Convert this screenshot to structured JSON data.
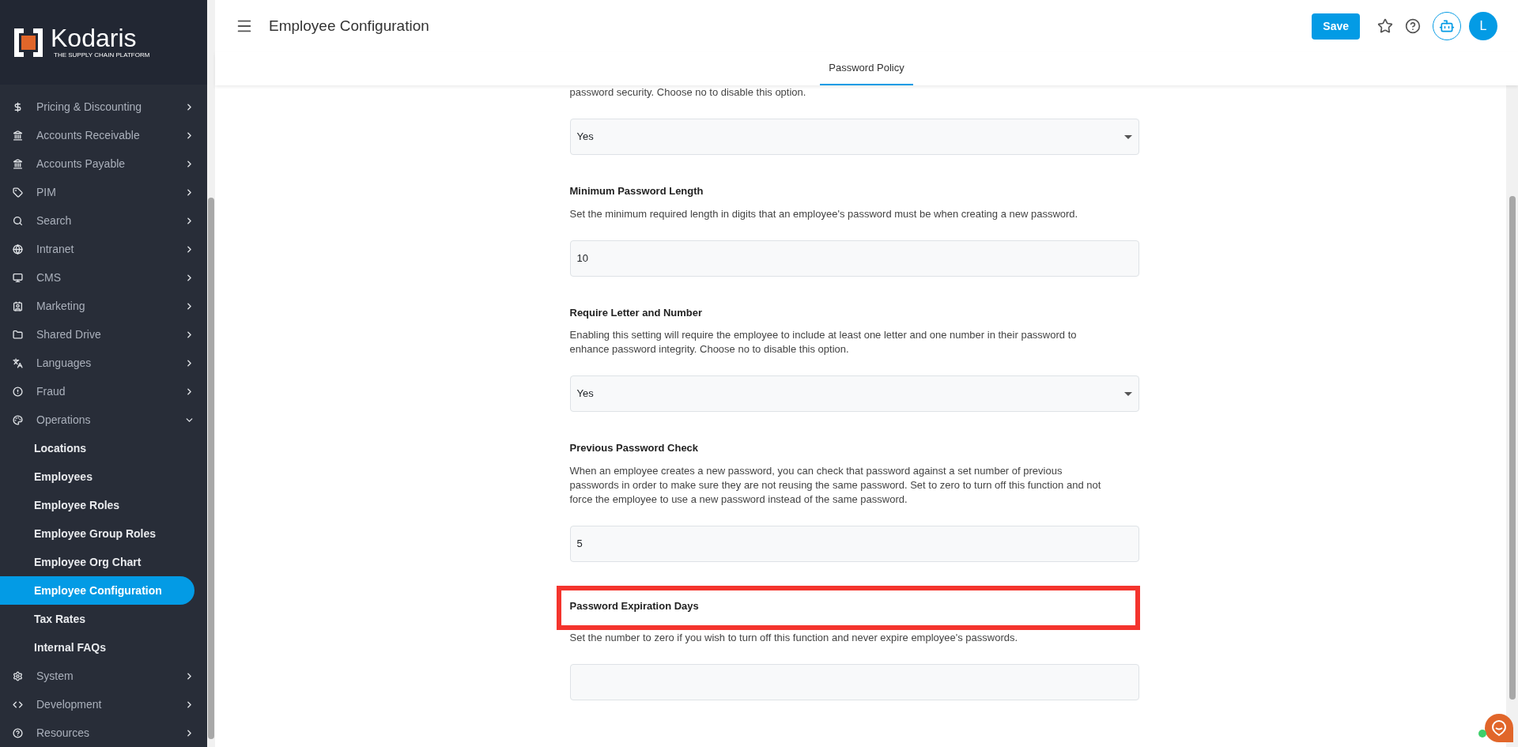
{
  "sidebar": {
    "logo": {
      "name": "Kodaris",
      "tagline": "THE SUPPLY CHAIN PLATFORM"
    },
    "items": [
      {
        "label": "Pricing & Discounting",
        "expanded": false
      },
      {
        "label": "Accounts Receivable",
        "expanded": false
      },
      {
        "label": "Accounts Payable",
        "expanded": false
      },
      {
        "label": "PIM",
        "expanded": false
      },
      {
        "label": "Search",
        "expanded": false
      },
      {
        "label": "Intranet",
        "expanded": false
      },
      {
        "label": "CMS",
        "expanded": false
      },
      {
        "label": "Marketing",
        "expanded": false
      },
      {
        "label": "Shared Drive",
        "expanded": false
      },
      {
        "label": "Languages",
        "expanded": false
      },
      {
        "label": "Fraud",
        "expanded": false
      },
      {
        "label": "Operations",
        "expanded": true,
        "children": [
          {
            "label": "Locations",
            "selected": false
          },
          {
            "label": "Employees",
            "selected": false
          },
          {
            "label": "Employee Roles",
            "selected": false
          },
          {
            "label": "Employee Group Roles",
            "selected": false
          },
          {
            "label": "Employee Org Chart",
            "selected": false
          },
          {
            "label": "Employee Configuration",
            "selected": true
          },
          {
            "label": "Tax Rates",
            "selected": false
          },
          {
            "label": "Internal FAQs",
            "selected": false
          }
        ]
      },
      {
        "label": "System",
        "expanded": false
      },
      {
        "label": "Development",
        "expanded": false
      },
      {
        "label": "Resources",
        "expanded": false
      }
    ]
  },
  "header": {
    "title": "Employee Configuration",
    "save": "Save",
    "avatar": "L"
  },
  "tabs": [
    {
      "label": "Password Policy",
      "selected": true
    }
  ],
  "sections": [
    {
      "description": "password security. Choose no to disable this option.",
      "kind": "select",
      "value": "Yes",
      "highlighted": false
    },
    {
      "title": "Minimum Password Length",
      "description": "Set the minimum required length in digits that an employee's password must be when creating a new password.",
      "kind": "input",
      "value": "10",
      "highlighted": false
    },
    {
      "title": "Require Letter and Number",
      "description": "Enabling this setting will require the employee to include at least one letter and one number in their password to enhance password integrity. Choose no to disable this option.",
      "kind": "select",
      "value": "Yes",
      "highlighted": false
    },
    {
      "title": "Previous Password Check",
      "description": "When an employee creates a new password, you can check that password against a set number of previous passwords in order to make sure they are not reusing the same password. Set to zero to turn off this function and not force the employee to use a new password instead of the same password.",
      "kind": "input",
      "value": "5",
      "highlighted": false
    },
    {
      "title": "Password Expiration Days",
      "description": "Set the number to zero if you wish to turn off this function and never expire employee's passwords.",
      "kind": "input",
      "highlighted": true
    }
  ]
}
